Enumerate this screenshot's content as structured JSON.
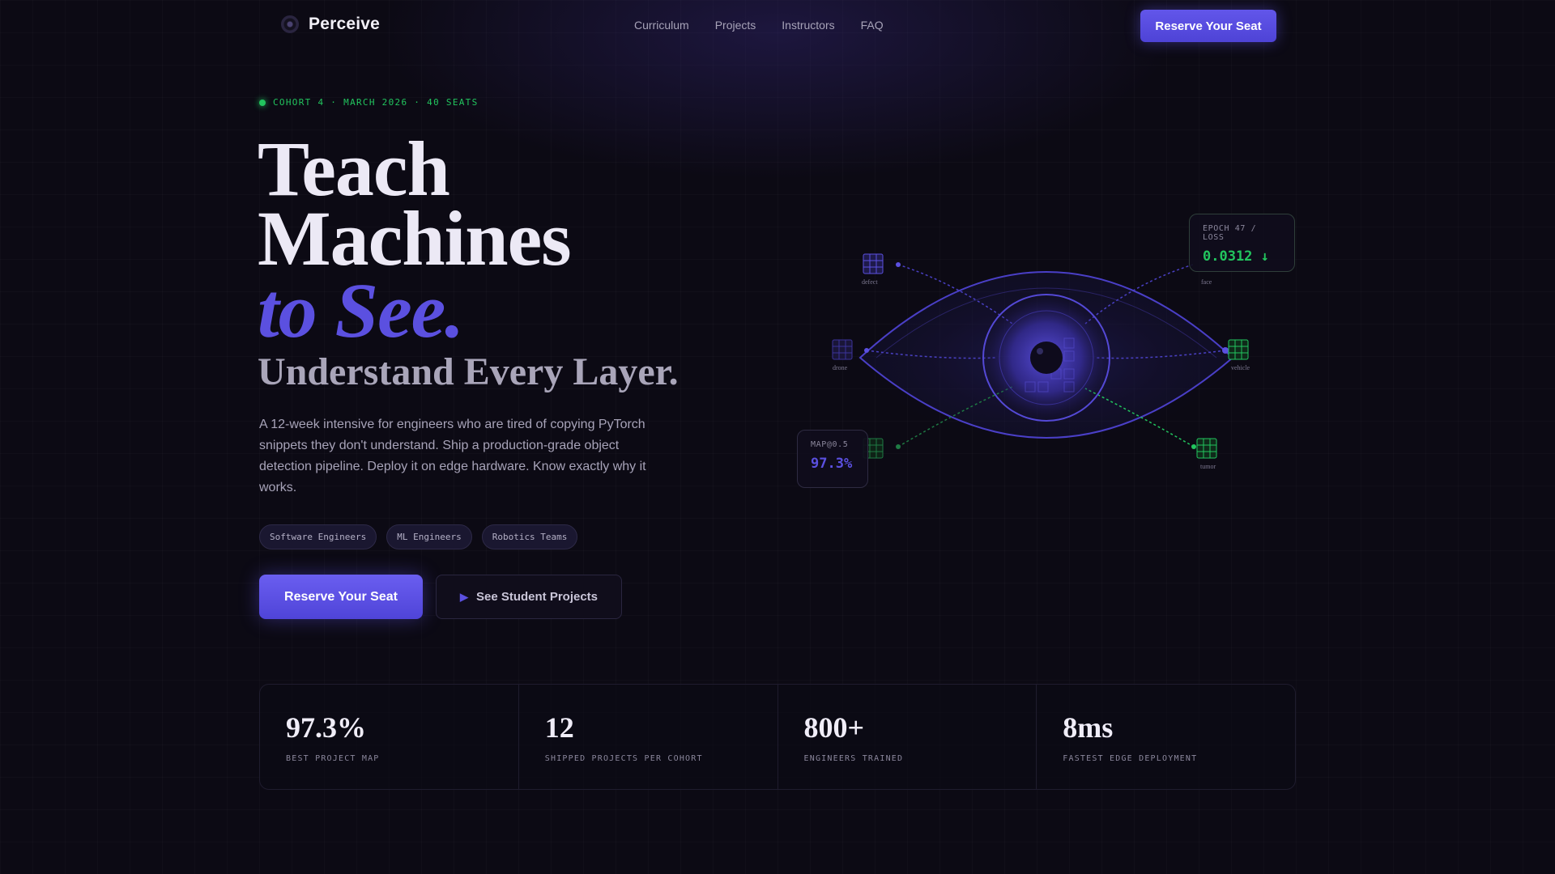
{
  "nav": {
    "brand": "Perceive",
    "links": [
      "Curriculum",
      "Projects",
      "Instructors",
      "FAQ"
    ],
    "cta": "Reserve Your Seat"
  },
  "hero": {
    "cohort": "COHORT 4 · MARCH 2026 · 40 SEATS",
    "line1": "Teach",
    "line2": "Machines",
    "accent": "to See.",
    "subline": "Understand Every Layer.",
    "description": "A 12-week intensive for engineers who are tired of copying PyTorch snippets they don't understand. Ship a production-grade object detection pipeline. Deploy it on edge hardware. Know exactly why it works.",
    "tags": [
      "Software Engineers",
      "ML Engineers",
      "Robotics Teams"
    ],
    "primary_cta": "Reserve Your Seat",
    "secondary_cta": "See Student Projects"
  },
  "visual": {
    "nodes": {
      "defect": "defect",
      "face": "face",
      "drone": "drone",
      "vehicle": "vehicle",
      "tumor": "tumor"
    },
    "epoch_card": {
      "label": "EPOCH 47 / LOSS",
      "value": "0.0312 ↓"
    },
    "map_card": {
      "label": "MAP@0.5",
      "value": "97.3%"
    }
  },
  "stats": [
    {
      "value": "97.3%",
      "label": "BEST PROJECT MAP"
    },
    {
      "value": "12",
      "label": "SHIPPED PROJECTS PER COHORT"
    },
    {
      "value": "800+",
      "label": "ENGINEERS TRAINED"
    },
    {
      "value": "8ms",
      "label": "FASTEST EDGE DEPLOYMENT"
    }
  ],
  "colors": {
    "background": "#0c0a14",
    "accent": "#5b50e0",
    "success": "#22c55e",
    "text": "#ece9f5",
    "muted": "#a7a3b8"
  }
}
